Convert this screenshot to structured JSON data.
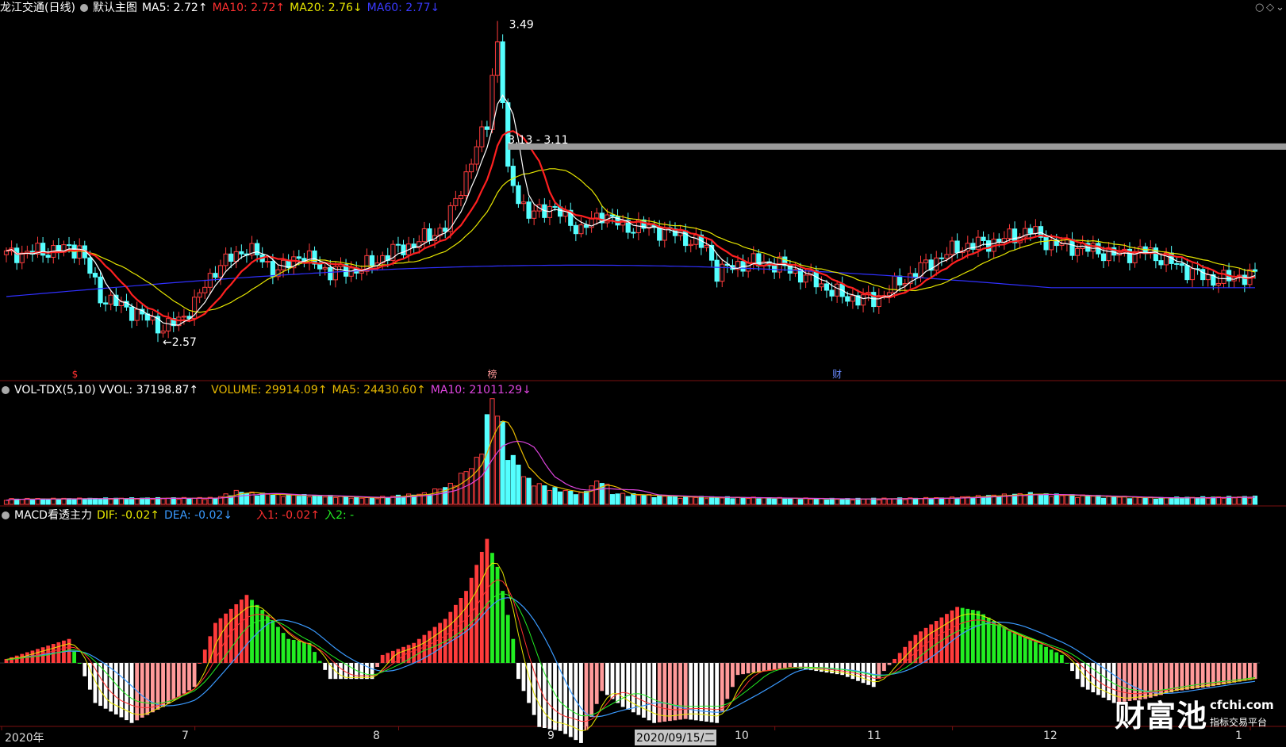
{
  "main_header": {
    "title": "龙江交通(日线)",
    "chart_name": "默认主图",
    "ma5": "MA5: 2.72↑",
    "ma10": "MA10: 2.72↑",
    "ma20": "MA20: 2.76↓",
    "ma60": "MA60: 2.77↓"
  },
  "vol_header": {
    "name": "VOL-TDX(5,10)",
    "vvol": "VVOL: 37198.87↑",
    "volume": "VOLUME: 29914.09↑",
    "ma5": "MA5: 24430.60↑",
    "ma10": "MA10: 21011.29↓"
  },
  "macd_header": {
    "name": "MACD看透主力",
    "dif": "DIF: -0.02↑",
    "dea": "DEA: -0.02↓",
    "in1": "入1: -0.02↑",
    "in2": "入2: -"
  },
  "annotations": {
    "high": "3.49",
    "low": "2.57",
    "resistance": "3.13 - 3.11",
    "marker_1": "$",
    "marker_2": "榜",
    "marker_3": "财"
  },
  "x_axis": {
    "year": "2020年",
    "m7": "7",
    "m8": "8",
    "m9": "9",
    "cursor_date": "2020/09/15/二",
    "m10": "10",
    "m11": "11",
    "m12": "12",
    "m1": "1"
  },
  "brand": {
    "name": "财富池",
    "domain": "cfchi.com",
    "tagline": "指标交易平台"
  },
  "corner_icons": [
    "circle-icon",
    "diamond-icon",
    "chevron-down-icon"
  ],
  "colors": {
    "up": "#ff3b3b",
    "down": "#54ffff",
    "ma5": "#ffffff",
    "ma10": "#ff2020",
    "ma20": "#e6e600",
    "ma60": "#3030ff",
    "macd_green": "#22ee22",
    "macd_red": "#ff3b3b"
  },
  "chart_data": {
    "type": "candlestick",
    "price_range": [
      2.5,
      3.5
    ],
    "key_prices": {
      "high": 3.49,
      "low": 2.57,
      "zone": [
        3.11,
        3.13
      ]
    },
    "price_anchors": [
      [
        0,
        2.82
      ],
      [
        14,
        2.84
      ],
      [
        18,
        2.7
      ],
      [
        24,
        2.66
      ],
      [
        30,
        2.61
      ],
      [
        33,
        2.63
      ],
      [
        36,
        2.68
      ],
      [
        40,
        2.78
      ],
      [
        46,
        2.84
      ],
      [
        52,
        2.77
      ],
      [
        56,
        2.82
      ],
      [
        62,
        2.77
      ],
      [
        68,
        2.78
      ],
      [
        74,
        2.83
      ],
      [
        78,
        2.85
      ],
      [
        84,
        2.9
      ],
      [
        88,
        3.05
      ],
      [
        92,
        3.2
      ],
      [
        94,
        3.48
      ],
      [
        96,
        3.05
      ],
      [
        100,
        2.93
      ],
      [
        104,
        2.96
      ],
      [
        110,
        2.89
      ],
      [
        114,
        2.94
      ],
      [
        118,
        2.9
      ],
      [
        122,
        2.9
      ],
      [
        128,
        2.88
      ],
      [
        134,
        2.84
      ],
      [
        136,
        2.77
      ],
      [
        142,
        2.8
      ],
      [
        148,
        2.79
      ],
      [
        154,
        2.75
      ],
      [
        160,
        2.7
      ],
      [
        166,
        2.69
      ],
      [
        170,
        2.73
      ],
      [
        176,
        2.79
      ],
      [
        182,
        2.84
      ],
      [
        190,
        2.86
      ],
      [
        196,
        2.89
      ],
      [
        200,
        2.85
      ],
      [
        206,
        2.84
      ],
      [
        212,
        2.82
      ],
      [
        218,
        2.83
      ],
      [
        224,
        2.79
      ],
      [
        230,
        2.75
      ],
      [
        234,
        2.75
      ],
      [
        236,
        2.76
      ],
      [
        239,
        2.76
      ]
    ],
    "volume_anchors": [
      [
        0,
        0.05
      ],
      [
        40,
        0.06
      ],
      [
        44,
        0.12
      ],
      [
        48,
        0.1
      ],
      [
        52,
        0.09
      ],
      [
        60,
        0.08
      ],
      [
        70,
        0.06
      ],
      [
        80,
        0.1
      ],
      [
        85,
        0.18
      ],
      [
        90,
        0.4
      ],
      [
        92,
        0.78
      ],
      [
        93,
        0.98
      ],
      [
        94,
        0.9
      ],
      [
        96,
        0.5
      ],
      [
        100,
        0.22
      ],
      [
        104,
        0.15
      ],
      [
        110,
        0.1
      ],
      [
        114,
        0.24
      ],
      [
        116,
        0.1
      ],
      [
        130,
        0.07
      ],
      [
        160,
        0.05
      ],
      [
        180,
        0.06
      ],
      [
        196,
        0.1
      ],
      [
        200,
        0.09
      ],
      [
        220,
        0.06
      ],
      [
        239,
        0.07
      ]
    ],
    "macd_anchors": [
      [
        0,
        0.05
      ],
      [
        12,
        0.3
      ],
      [
        14,
        0.0
      ],
      [
        17,
        -0.5
      ],
      [
        24,
        -0.75
      ],
      [
        30,
        -0.55
      ],
      [
        36,
        -0.3
      ],
      [
        37,
        0.0
      ],
      [
        40,
        0.5
      ],
      [
        46,
        0.85
      ],
      [
        50,
        0.6
      ],
      [
        54,
        0.3
      ],
      [
        58,
        0.25
      ],
      [
        62,
        -0.2
      ],
      [
        70,
        -0.2
      ],
      [
        72,
        0.1
      ],
      [
        78,
        0.25
      ],
      [
        84,
        0.55
      ],
      [
        88,
        0.9
      ],
      [
        92,
        1.55
      ],
      [
        94,
        1.2
      ],
      [
        97,
        0.3
      ],
      [
        98,
        -0.2
      ],
      [
        102,
        -0.8
      ],
      [
        106,
        -0.85
      ],
      [
        110,
        -1.0
      ],
      [
        114,
        -0.35
      ],
      [
        118,
        -0.55
      ],
      [
        124,
        -0.75
      ],
      [
        130,
        -0.7
      ],
      [
        136,
        -0.75
      ],
      [
        140,
        -0.15
      ],
      [
        150,
        -0.05
      ],
      [
        160,
        -0.15
      ],
      [
        166,
        -0.3
      ],
      [
        168,
        -0.1
      ],
      [
        174,
        0.35
      ],
      [
        182,
        0.7
      ],
      [
        186,
        0.65
      ],
      [
        192,
        0.4
      ],
      [
        196,
        0.3
      ],
      [
        202,
        0.1
      ],
      [
        206,
        -0.3
      ],
      [
        212,
        -0.5
      ],
      [
        218,
        -0.45
      ],
      [
        224,
        -0.35
      ],
      [
        230,
        -0.3
      ],
      [
        239,
        -0.2
      ]
    ]
  }
}
